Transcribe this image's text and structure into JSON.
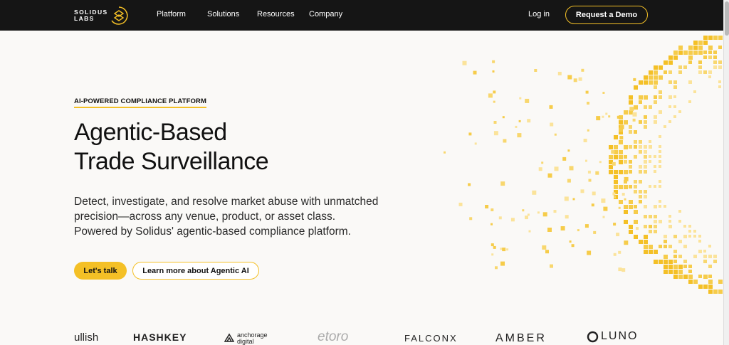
{
  "brand": {
    "line1": "SOLIDUS",
    "line2": "LABS",
    "accent": "#f4c026",
    "nav_bg": "#151515"
  },
  "nav": {
    "links": [
      "Platform",
      "Solutions",
      "Resources",
      "Company"
    ],
    "login": "Log in",
    "cta": "Request a Demo"
  },
  "hero": {
    "eyebrow": "AI-POWERED COMPLIANCE PLATFORM",
    "title_line1": "Agentic-Based",
    "title_line2": "Trade Surveillance",
    "sub_line1": "Detect, investigate, and resolve market abuse with unmatched",
    "sub_line2": "precision—across any venue, product, or asset class.",
    "sub_line3": "Powered by Solidus' agentic-based compliance platform.",
    "cta_primary": "Let's talk",
    "cta_secondary": "Learn more about Agentic AI"
  },
  "clients": {
    "bullish": "ullish",
    "hashkey": "HASHKEY",
    "anchorage_1": "anchorage",
    "anchorage_2": "digital",
    "etoro": "etoro",
    "falconx": "FALCONX",
    "amber": "AMBER",
    "luno": "LUNO"
  },
  "icons": [
    "solidus-logo-icon",
    "anchorage-logo-icon",
    "luno-logo-icon",
    "pixel-arc-graphic"
  ]
}
